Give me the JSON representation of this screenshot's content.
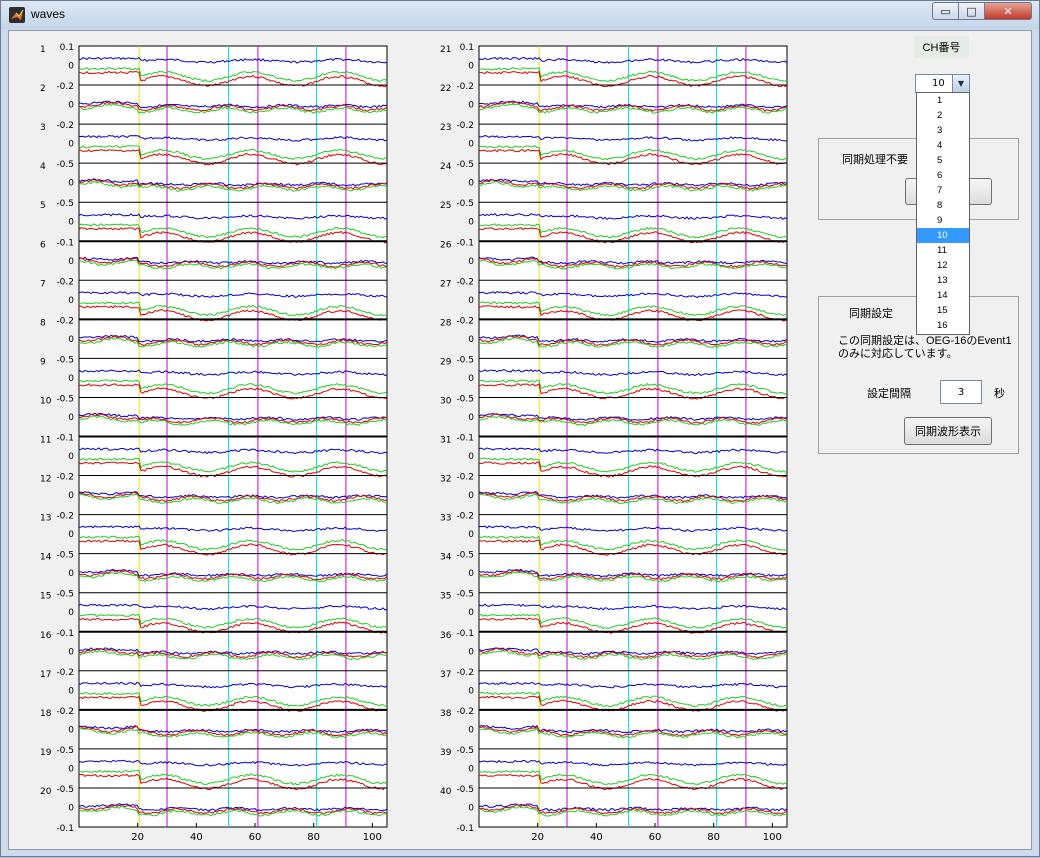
{
  "window": {
    "title": "waves"
  },
  "titlebar_buttons": {
    "minimize": "▭",
    "maximize": "□",
    "close": "✕"
  },
  "plots": {
    "left": {
      "channels": [
        {
          "ch": "1",
          "top": "0.1",
          "mid": "0"
        },
        {
          "ch": "2",
          "top": "-0.2",
          "mid": "0"
        },
        {
          "ch": "3",
          "top": "-0.2",
          "mid": "0"
        },
        {
          "ch": "4",
          "top": "-0.5",
          "mid": "0"
        },
        {
          "ch": "5",
          "top": "-0.5",
          "mid": "0"
        },
        {
          "ch": "6",
          "top": "-0.1",
          "mid": "0"
        },
        {
          "ch": "7",
          "top": "-0.2",
          "mid": "0"
        },
        {
          "ch": "8",
          "top": "-0.2",
          "mid": "0"
        },
        {
          "ch": "9",
          "top": "-0.5",
          "mid": "0"
        },
        {
          "ch": "10",
          "top": "-0.5",
          "mid": "0"
        },
        {
          "ch": "11",
          "top": "-0.1",
          "mid": "0"
        },
        {
          "ch": "12",
          "top": "-0.2",
          "mid": "0"
        },
        {
          "ch": "13",
          "top": "-0.2",
          "mid": "0"
        },
        {
          "ch": "14",
          "top": "-0.5",
          "mid": "0"
        },
        {
          "ch": "15",
          "top": "-0.5",
          "mid": "0"
        },
        {
          "ch": "16",
          "top": "-0.1",
          "mid": "0"
        },
        {
          "ch": "17",
          "top": "-0.2",
          "mid": "0"
        },
        {
          "ch": "18",
          "top": "-0.2",
          "mid": "0"
        },
        {
          "ch": "19",
          "top": "-0.5",
          "mid": "0"
        },
        {
          "ch": "20",
          "top": "-0.5",
          "mid": "0"
        }
      ],
      "bottom_label": "-0.1"
    },
    "right": {
      "channels": [
        {
          "ch": "21",
          "top": "0.1",
          "mid": "0"
        },
        {
          "ch": "22",
          "top": "-0.2",
          "mid": "0"
        },
        {
          "ch": "23",
          "top": "-0.2",
          "mid": "0"
        },
        {
          "ch": "24",
          "top": "-0.5",
          "mid": "0"
        },
        {
          "ch": "25",
          "top": "-0.5",
          "mid": "0"
        },
        {
          "ch": "26",
          "top": "-0.1",
          "mid": "0"
        },
        {
          "ch": "27",
          "top": "-0.2",
          "mid": "0"
        },
        {
          "ch": "28",
          "top": "-0.2",
          "mid": "0"
        },
        {
          "ch": "29",
          "top": "-0.5",
          "mid": "0"
        },
        {
          "ch": "30",
          "top": "-0.5",
          "mid": "0"
        },
        {
          "ch": "31",
          "top": "-0.1",
          "mid": "0"
        },
        {
          "ch": "32",
          "top": "-0.2",
          "mid": "0"
        },
        {
          "ch": "33",
          "top": "-0.2",
          "mid": "0"
        },
        {
          "ch": "34",
          "top": "-0.5",
          "mid": "0"
        },
        {
          "ch": "35",
          "top": "-0.5",
          "mid": "0"
        },
        {
          "ch": "36",
          "top": "-0.1",
          "mid": "0"
        },
        {
          "ch": "37",
          "top": "-0.2",
          "mid": "0"
        },
        {
          "ch": "38",
          "top": "-0.2",
          "mid": "0"
        },
        {
          "ch": "39",
          "top": "-0.5",
          "mid": "0"
        },
        {
          "ch": "40",
          "top": "-0.5",
          "mid": "0"
        }
      ],
      "bottom_label": "-0.1"
    },
    "x_ticks": [
      "20",
      "40",
      "60",
      "80",
      "100"
    ],
    "x_range": [
      0,
      105
    ],
    "series_colors": {
      "blue": "#0000cc",
      "red": "#e00000",
      "green": "#22cc22",
      "yellow": "#cccc00"
    },
    "marker_colors": {
      "yellow": "#e6e600",
      "magenta": "#cc00cc",
      "cyan": "#00dddd",
      "gray": "#707070"
    },
    "marker_lines": {
      "yellow_x": 20.5,
      "magenta_x": [
        30,
        61,
        91
      ],
      "cyan_x": [
        51,
        81
      ]
    }
  },
  "controls": {
    "ch_label": "CH番号",
    "ch_selected": "10",
    "ch_options": [
      "1",
      "2",
      "3",
      "4",
      "5",
      "6",
      "7",
      "8",
      "9",
      "10",
      "11",
      "12",
      "13",
      "14",
      "15",
      "16"
    ],
    "sync_unneeded_label": "同期処理不要",
    "sync_settings_title": "同期設定",
    "sync_note_line1": "この同期設定は、OEG-16のEvent1",
    "sync_note_line2": "のみに対応しています。",
    "interval_label": "設定間隔",
    "interval_value": "3",
    "interval_unit": "秒",
    "show_sync_button": "同期波形表示"
  }
}
